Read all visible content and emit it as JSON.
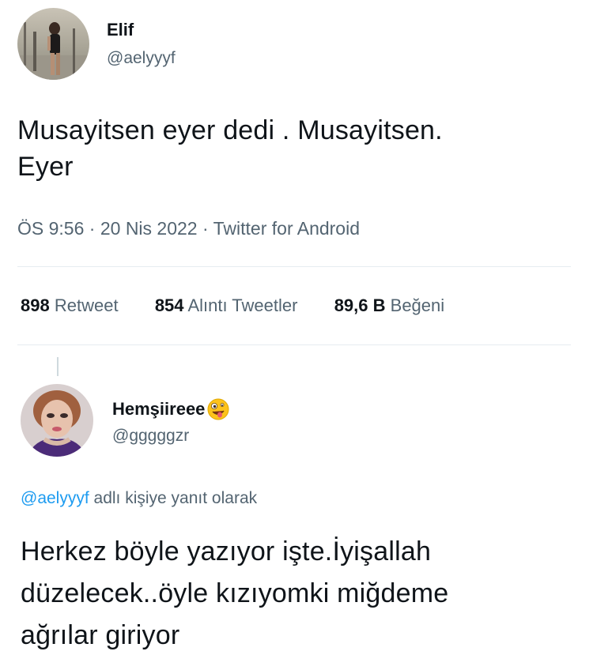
{
  "main_tweet": {
    "author_name": "Elif",
    "author_handle": "@aelyyyf",
    "text_line1": "Musayitsen eyer dedi . Musayitsen.",
    "text_line2": "Eyer",
    "timestamp": "ÖS 9:56",
    "date": "20 Nis 2022",
    "source": "Twitter for Android",
    "separator": "·"
  },
  "stats": {
    "retweets_count": "898",
    "retweets_label": "Retweet",
    "quotes_count": "854",
    "quotes_label": "Alıntı Tweetler",
    "likes_count": "89,6 B",
    "likes_label": "Beğeni"
  },
  "reply_tweet": {
    "author_name": "Hemşiireee",
    "author_emoji": "zany-face-emoji",
    "author_handle": "@gggggzr",
    "reply_to_handle": "@aelyyyf",
    "reply_context": " adlı kişiye yanıt olarak",
    "text_line1": "Herkez böyle yazıyor işte.İyişallah",
    "text_line2": "düzelecek..öyle kızıyomki miğdeme",
    "text_line3": "ağrılar giriyor"
  },
  "colors": {
    "link": "#1d9bf0",
    "secondary_text": "#536471",
    "divider": "#e6ecf0"
  }
}
